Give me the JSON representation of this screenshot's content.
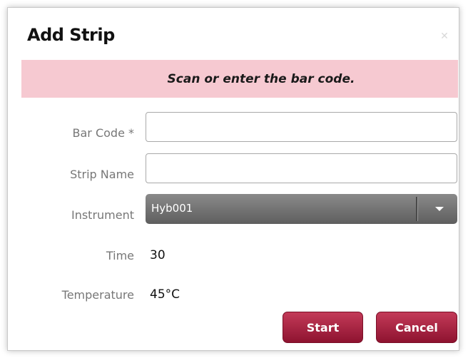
{
  "dialog": {
    "title": "Add Strip",
    "close_icon": "close-icon",
    "banner_text": "Scan or enter the bar code."
  },
  "form": {
    "bar_code": {
      "label": "Bar Code *",
      "value": ""
    },
    "strip_name": {
      "label": "Strip Name",
      "value": ""
    },
    "instrument": {
      "label": "Instrument",
      "selected": "Hyb001",
      "icon": "chevron-down-icon"
    },
    "time": {
      "label": "Time",
      "value": "30"
    },
    "temperature": {
      "label": "Temperature",
      "value": "45°C"
    }
  },
  "buttons": {
    "start": "Start",
    "cancel": "Cancel"
  },
  "colors": {
    "banner": "#f6c9d1",
    "button": "#a7203f",
    "select": "#6e6e6e"
  }
}
